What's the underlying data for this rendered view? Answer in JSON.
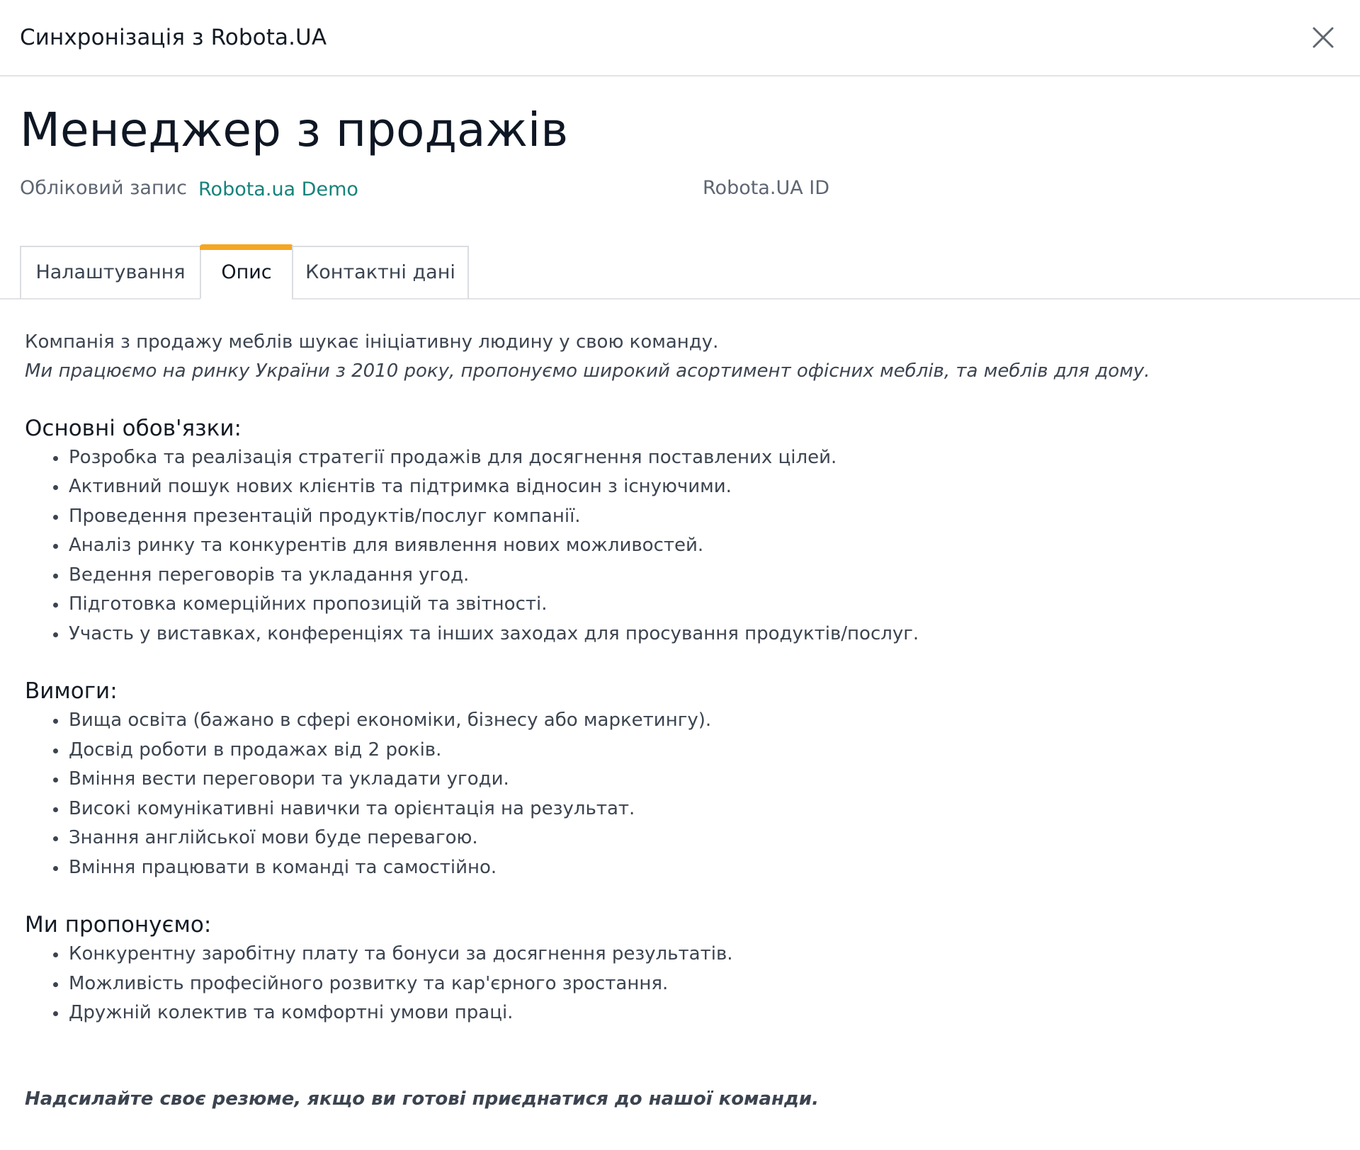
{
  "header": {
    "title": "Синхронізація з Robota.UA",
    "close_icon": "close-icon"
  },
  "vacancy": {
    "title": "Менеджер з продажів"
  },
  "meta": {
    "account_label": "Обліковий запис",
    "account_value": "Robota.ua Demo",
    "id_label": "Robota.UA ID"
  },
  "tabs": [
    {
      "label": "Налаштування",
      "active": false
    },
    {
      "label": "Опис",
      "active": true
    },
    {
      "label": "Контактні дані",
      "active": false
    }
  ],
  "colors": {
    "accent_tab": "#f5a623",
    "link": "#16837a"
  },
  "description": {
    "intro": "Компанія з продажу меблів шукає ініціативну людину у свою команду.",
    "intro_italic": "Ми працюємо на ринку України з 2010 року, пропонуємо широкий асортимент офісних меблів, та меблів для дому.",
    "sections": [
      {
        "title": "Основні обов'язки:",
        "items": [
          "Розробка та реалізація стратегії продажів для досягнення поставлених цілей.",
          "Активний пошук нових клієнтів та підтримка відносин з існуючими.",
          "Проведення презентацій продуктів/послуг компанії.",
          "Аналіз ринку та конкурентів для виявлення нових можливостей.",
          "Ведення переговорів та укладання угод.",
          "Підготовка комерційних пропозицій та звітності.",
          "Участь у виставках, конференціях та інших заходах для просування продуктів/послуг."
        ]
      },
      {
        "title": "Вимоги:",
        "items": [
          "Вища освіта (бажано в сфері економіки, бізнесу або маркетингу).",
          "Досвід роботи в продажах від 2 років.",
          "Вміння вести переговори та укладати угоди.",
          "Високі комунікативні навички та орієнтація на результат.",
          "Знання англійської мови буде перевагою.",
          "Вміння працювати в команді та самостійно."
        ]
      },
      {
        "title": "Ми пропонуємо:",
        "items": [
          "Конкурентну заробітну плату та бонуси за досягнення результатів.",
          "Можливість професійного розвитку та кар'єрного зростання.",
          "Дружній колектив та комфортні умови праці."
        ]
      }
    ],
    "footer": "Надсилайте своє резюме, якщо ви готові приєднатися до нашої команди."
  }
}
